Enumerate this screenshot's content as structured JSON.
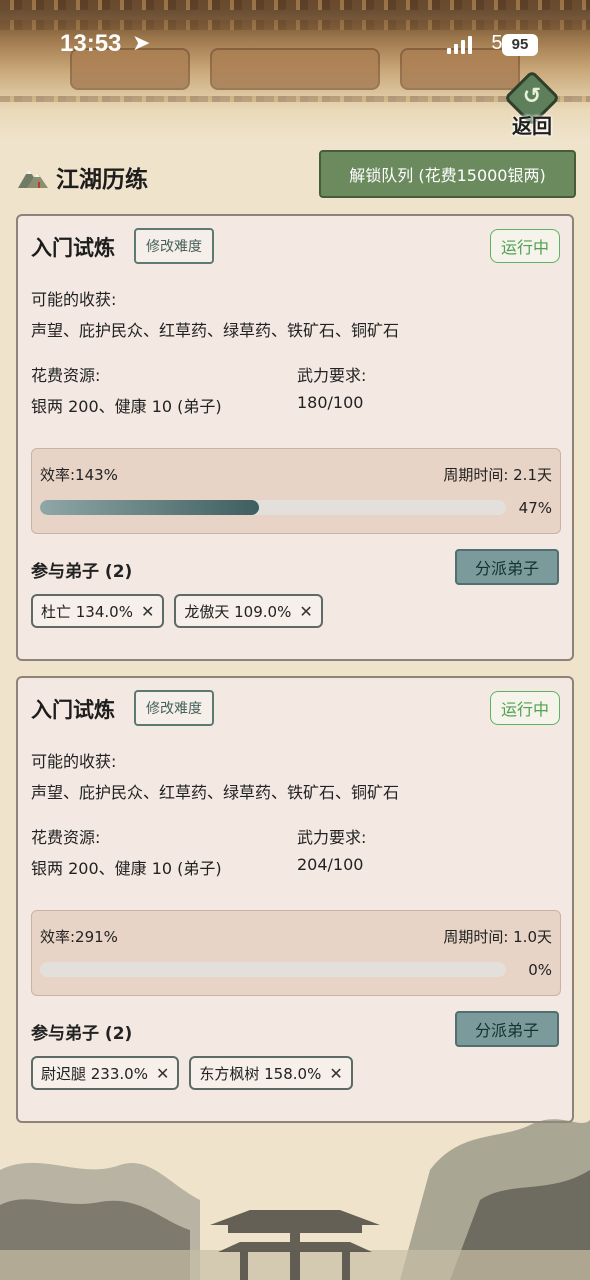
{
  "status": {
    "time": "13:53",
    "network": "5G",
    "battery": "95"
  },
  "header": {
    "back_label": "返回",
    "back_glyph": "↺"
  },
  "page": {
    "title": "江湖历练",
    "unlock_button": "解锁队列 (花费15000银两)"
  },
  "cards": [
    {
      "title": "入门试炼",
      "difficulty_button": "修改难度",
      "status": "运行中",
      "rewards_label": "可能的收获:",
      "rewards": "声望、庇护民众、红草药、绿草药、铁矿石、铜矿石",
      "cost_label": "花费资源:",
      "cost": "银两 200、健康 10 (弟子)",
      "power_label": "武力要求:",
      "power": "180/100",
      "efficiency": "效率:143%",
      "cycle": "周期时间: 2.1天",
      "progress": 47,
      "progress_text": "47%",
      "disciples_label": "参与弟子 (2)",
      "assign_button": "分派弟子",
      "disciples": [
        {
          "label": "杜亡 134.0%"
        },
        {
          "label": "龙傲天 109.0%"
        }
      ]
    },
    {
      "title": "入门试炼",
      "difficulty_button": "修改难度",
      "status": "运行中",
      "rewards_label": "可能的收获:",
      "rewards": "声望、庇护民众、红草药、绿草药、铁矿石、铜矿石",
      "cost_label": "花费资源:",
      "cost": "银两 200、健康 10 (弟子)",
      "power_label": "武力要求:",
      "power": "204/100",
      "efficiency": "效率:291%",
      "cycle": "周期时间: 1.0天",
      "progress": 0,
      "progress_text": "0%",
      "disciples_label": "参与弟子 (2)",
      "assign_button": "分派弟子",
      "disciples": [
        {
          "label": "尉迟腿 233.0%"
        },
        {
          "label": "东方枫树 158.0%"
        }
      ]
    }
  ],
  "chip_remove_glyph": "✕",
  "colors": {
    "accent_green": "#6b8a5e",
    "running_green": "#4fa154",
    "teal": "#7a9a9b"
  }
}
